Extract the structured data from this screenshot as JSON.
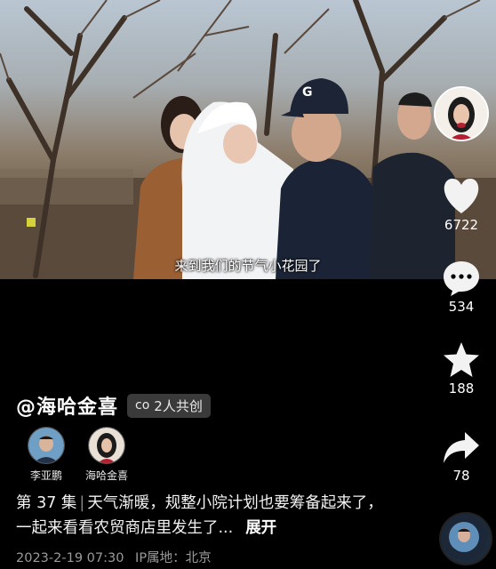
{
  "video": {
    "subtitle": "来到我们的节气小花园了"
  },
  "author": {
    "handle": "@海哈金喜",
    "cocreate_icon": "co-link-icon",
    "cocreate_label": "2人共创",
    "cocreate_prefix": "co"
  },
  "creators": [
    {
      "name": "李亚鹏"
    },
    {
      "name": "海哈金喜"
    }
  ],
  "caption": {
    "episode": "第 37 集",
    "text": "天气渐暖，规整小院计划也要筹备起来了，一起来看看农贸商店里发生了...",
    "more": "展开"
  },
  "meta": {
    "datetime": "2023-2-19 07:30",
    "ip_label": "IP属地：北京"
  },
  "actions": {
    "likes": "6722",
    "comments": "534",
    "favorites": "188",
    "shares": "78"
  },
  "colors": {
    "accent_dot": "#b61f32",
    "background": "#000000"
  }
}
